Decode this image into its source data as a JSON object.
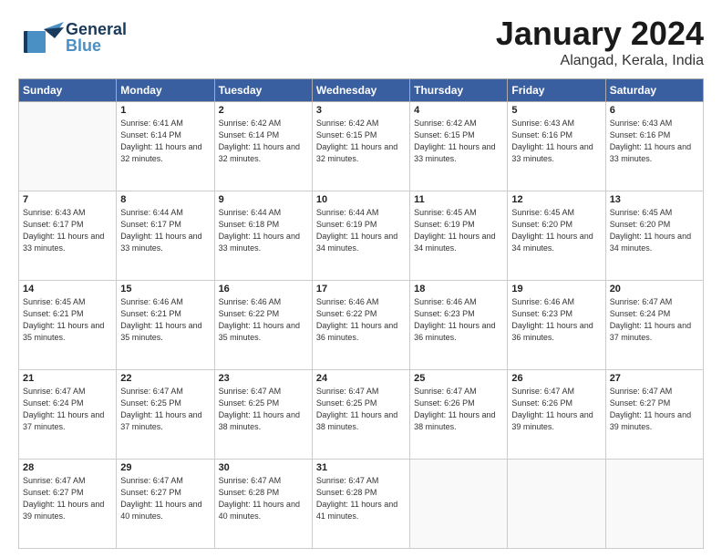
{
  "logo": {
    "general": "General",
    "blue": "Blue"
  },
  "title": "January 2024",
  "location": "Alangad, Kerala, India",
  "days_header": [
    "Sunday",
    "Monday",
    "Tuesday",
    "Wednesday",
    "Thursday",
    "Friday",
    "Saturday"
  ],
  "weeks": [
    [
      {
        "num": "",
        "sunrise": "",
        "sunset": "",
        "daylight": ""
      },
      {
        "num": "1",
        "sunrise": "Sunrise: 6:41 AM",
        "sunset": "Sunset: 6:14 PM",
        "daylight": "Daylight: 11 hours and 32 minutes."
      },
      {
        "num": "2",
        "sunrise": "Sunrise: 6:42 AM",
        "sunset": "Sunset: 6:14 PM",
        "daylight": "Daylight: 11 hours and 32 minutes."
      },
      {
        "num": "3",
        "sunrise": "Sunrise: 6:42 AM",
        "sunset": "Sunset: 6:15 PM",
        "daylight": "Daylight: 11 hours and 32 minutes."
      },
      {
        "num": "4",
        "sunrise": "Sunrise: 6:42 AM",
        "sunset": "Sunset: 6:15 PM",
        "daylight": "Daylight: 11 hours and 33 minutes."
      },
      {
        "num": "5",
        "sunrise": "Sunrise: 6:43 AM",
        "sunset": "Sunset: 6:16 PM",
        "daylight": "Daylight: 11 hours and 33 minutes."
      },
      {
        "num": "6",
        "sunrise": "Sunrise: 6:43 AM",
        "sunset": "Sunset: 6:16 PM",
        "daylight": "Daylight: 11 hours and 33 minutes."
      }
    ],
    [
      {
        "num": "7",
        "sunrise": "Sunrise: 6:43 AM",
        "sunset": "Sunset: 6:17 PM",
        "daylight": "Daylight: 11 hours and 33 minutes."
      },
      {
        "num": "8",
        "sunrise": "Sunrise: 6:44 AM",
        "sunset": "Sunset: 6:17 PM",
        "daylight": "Daylight: 11 hours and 33 minutes."
      },
      {
        "num": "9",
        "sunrise": "Sunrise: 6:44 AM",
        "sunset": "Sunset: 6:18 PM",
        "daylight": "Daylight: 11 hours and 33 minutes."
      },
      {
        "num": "10",
        "sunrise": "Sunrise: 6:44 AM",
        "sunset": "Sunset: 6:19 PM",
        "daylight": "Daylight: 11 hours and 34 minutes."
      },
      {
        "num": "11",
        "sunrise": "Sunrise: 6:45 AM",
        "sunset": "Sunset: 6:19 PM",
        "daylight": "Daylight: 11 hours and 34 minutes."
      },
      {
        "num": "12",
        "sunrise": "Sunrise: 6:45 AM",
        "sunset": "Sunset: 6:20 PM",
        "daylight": "Daylight: 11 hours and 34 minutes."
      },
      {
        "num": "13",
        "sunrise": "Sunrise: 6:45 AM",
        "sunset": "Sunset: 6:20 PM",
        "daylight": "Daylight: 11 hours and 34 minutes."
      }
    ],
    [
      {
        "num": "14",
        "sunrise": "Sunrise: 6:45 AM",
        "sunset": "Sunset: 6:21 PM",
        "daylight": "Daylight: 11 hours and 35 minutes."
      },
      {
        "num": "15",
        "sunrise": "Sunrise: 6:46 AM",
        "sunset": "Sunset: 6:21 PM",
        "daylight": "Daylight: 11 hours and 35 minutes."
      },
      {
        "num": "16",
        "sunrise": "Sunrise: 6:46 AM",
        "sunset": "Sunset: 6:22 PM",
        "daylight": "Daylight: 11 hours and 35 minutes."
      },
      {
        "num": "17",
        "sunrise": "Sunrise: 6:46 AM",
        "sunset": "Sunset: 6:22 PM",
        "daylight": "Daylight: 11 hours and 36 minutes."
      },
      {
        "num": "18",
        "sunrise": "Sunrise: 6:46 AM",
        "sunset": "Sunset: 6:23 PM",
        "daylight": "Daylight: 11 hours and 36 minutes."
      },
      {
        "num": "19",
        "sunrise": "Sunrise: 6:46 AM",
        "sunset": "Sunset: 6:23 PM",
        "daylight": "Daylight: 11 hours and 36 minutes."
      },
      {
        "num": "20",
        "sunrise": "Sunrise: 6:47 AM",
        "sunset": "Sunset: 6:24 PM",
        "daylight": "Daylight: 11 hours and 37 minutes."
      }
    ],
    [
      {
        "num": "21",
        "sunrise": "Sunrise: 6:47 AM",
        "sunset": "Sunset: 6:24 PM",
        "daylight": "Daylight: 11 hours and 37 minutes."
      },
      {
        "num": "22",
        "sunrise": "Sunrise: 6:47 AM",
        "sunset": "Sunset: 6:25 PM",
        "daylight": "Daylight: 11 hours and 37 minutes."
      },
      {
        "num": "23",
        "sunrise": "Sunrise: 6:47 AM",
        "sunset": "Sunset: 6:25 PM",
        "daylight": "Daylight: 11 hours and 38 minutes."
      },
      {
        "num": "24",
        "sunrise": "Sunrise: 6:47 AM",
        "sunset": "Sunset: 6:25 PM",
        "daylight": "Daylight: 11 hours and 38 minutes."
      },
      {
        "num": "25",
        "sunrise": "Sunrise: 6:47 AM",
        "sunset": "Sunset: 6:26 PM",
        "daylight": "Daylight: 11 hours and 38 minutes."
      },
      {
        "num": "26",
        "sunrise": "Sunrise: 6:47 AM",
        "sunset": "Sunset: 6:26 PM",
        "daylight": "Daylight: 11 hours and 39 minutes."
      },
      {
        "num": "27",
        "sunrise": "Sunrise: 6:47 AM",
        "sunset": "Sunset: 6:27 PM",
        "daylight": "Daylight: 11 hours and 39 minutes."
      }
    ],
    [
      {
        "num": "28",
        "sunrise": "Sunrise: 6:47 AM",
        "sunset": "Sunset: 6:27 PM",
        "daylight": "Daylight: 11 hours and 39 minutes."
      },
      {
        "num": "29",
        "sunrise": "Sunrise: 6:47 AM",
        "sunset": "Sunset: 6:27 PM",
        "daylight": "Daylight: 11 hours and 40 minutes."
      },
      {
        "num": "30",
        "sunrise": "Sunrise: 6:47 AM",
        "sunset": "Sunset: 6:28 PM",
        "daylight": "Daylight: 11 hours and 40 minutes."
      },
      {
        "num": "31",
        "sunrise": "Sunrise: 6:47 AM",
        "sunset": "Sunset: 6:28 PM",
        "daylight": "Daylight: 11 hours and 41 minutes."
      },
      {
        "num": "",
        "sunrise": "",
        "sunset": "",
        "daylight": ""
      },
      {
        "num": "",
        "sunrise": "",
        "sunset": "",
        "daylight": ""
      },
      {
        "num": "",
        "sunrise": "",
        "sunset": "",
        "daylight": ""
      }
    ]
  ]
}
